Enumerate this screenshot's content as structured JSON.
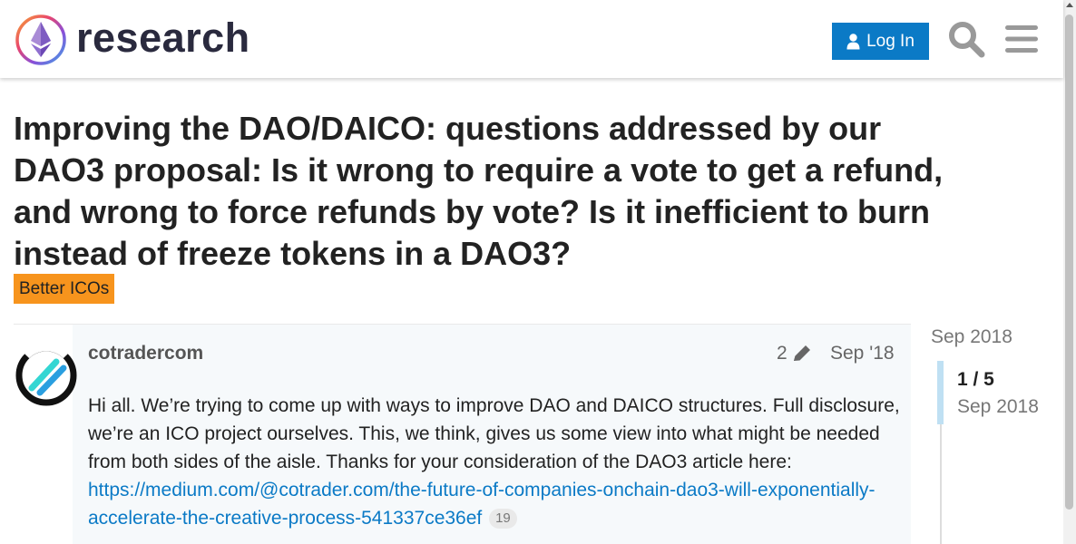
{
  "header": {
    "brand": "research",
    "login_label": "Log In",
    "icons": [
      "ethereum-logo",
      "user-icon",
      "search-icon",
      "hamburger-menu-icon"
    ]
  },
  "topic": {
    "title": "Improving the DAO/DAICO: questions addressed by our DAO3 proposal: Is it wrong to require a vote to get a refund, and wrong to force refunds by vote? Is it inefficient to burn instead of freeze tokens in a DAO3?",
    "category": "Better ICOs"
  },
  "post": {
    "username": "cotradercom",
    "edit_count": "2",
    "date": "Sep '18",
    "body_text": "Hi all. We’re trying to come up with ways to improve DAO and DAICO structures. Full disclosure, we’re an ICO project ourselves. This, we think, gives us some view into what might be needed from both sides of the aisle. Thanks for your consideration of the DAO3 article here: ",
    "link_text": "https://medium.com/@cotrader.com/the-future-of-companies-onchain-dao3-will-exponentially-accelerate-the-creative-process-541337ce36ef",
    "link_clicks": "19"
  },
  "timeline": {
    "top_date": "Sep 2018",
    "position": "1 / 5",
    "current_date": "Sep 2018",
    "progress_fraction": 0.2
  },
  "colors": {
    "primary_blue": "#0b7ac6",
    "category_orange": "#f7941d",
    "text": "#222222",
    "muted": "#777777",
    "timeline_handle": "#bfe0f3"
  }
}
